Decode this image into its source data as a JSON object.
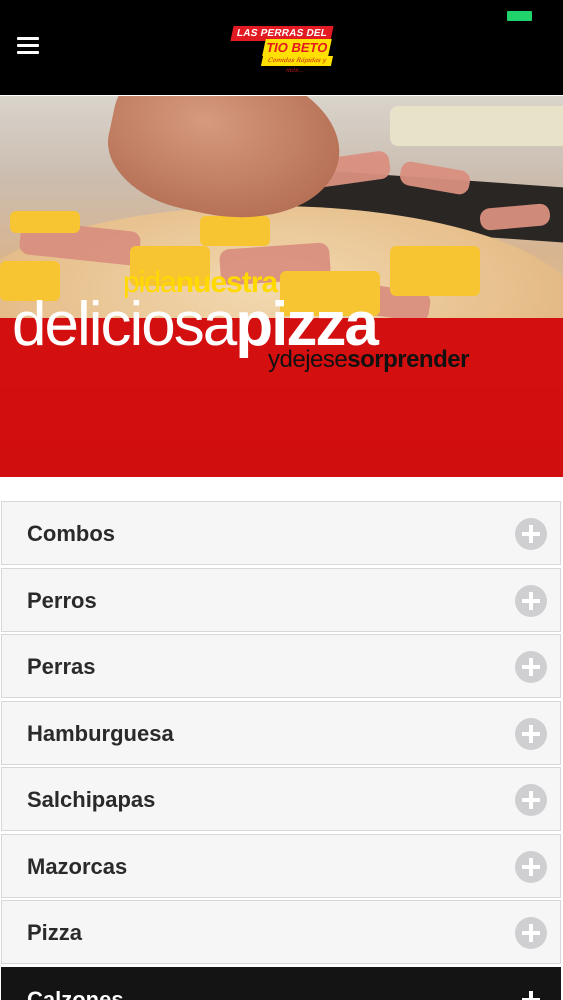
{
  "header": {
    "menu_icon": "hamburger-menu-icon",
    "logo": {
      "line1": "LAS PERRAS DEL",
      "line2": "TIO BETO",
      "tagline": "Comidas Rápidas y más..."
    },
    "battery_color": "#1fd36a"
  },
  "banner": {
    "line1_thin": "pida",
    "line1_bold": "nuestra",
    "line2_thin": "deliciosa",
    "line2_bold": "pizza",
    "line3_thin": "ydejese",
    "line3_bold": "sorprender",
    "accent_red": "#e01010",
    "accent_yellow": "#ffd900"
  },
  "menu": {
    "items": [
      {
        "label": "Combos",
        "icon": "plus-circle-icon"
      },
      {
        "label": "Perros",
        "icon": "plus-circle-icon"
      },
      {
        "label": "Perras",
        "icon": "plus-circle-icon"
      },
      {
        "label": "Hamburguesa",
        "icon": "plus-circle-icon"
      },
      {
        "label": "Salchipapas",
        "icon": "plus-circle-icon"
      },
      {
        "label": "Mazorcas",
        "icon": "plus-circle-icon"
      },
      {
        "label": "Pizza",
        "icon": "plus-circle-icon"
      },
      {
        "label": "Calzones",
        "icon": "plus-icon"
      }
    ]
  }
}
